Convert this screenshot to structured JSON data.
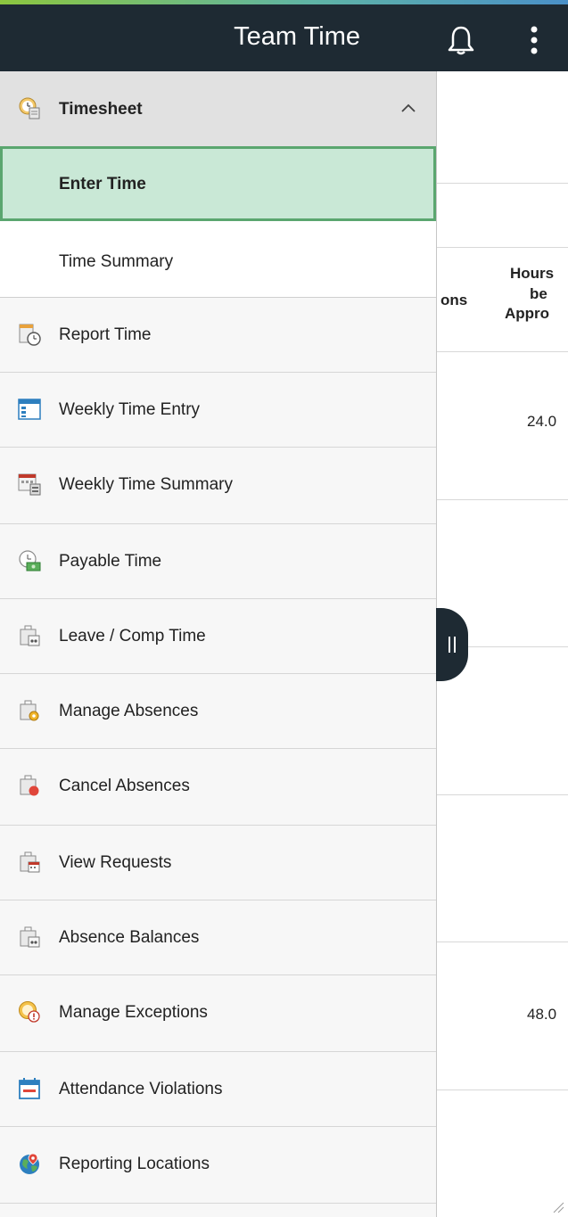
{
  "header": {
    "title": "Team Time",
    "bell_icon": "bell-icon",
    "menu_icon": "more-vertical-icon"
  },
  "background_table": {
    "col_partial_1": "ons",
    "col_hours_lines": [
      "Hours",
      "be",
      "Appro"
    ],
    "rows": [
      "24.0",
      "48.0"
    ]
  },
  "sidebar": {
    "group": {
      "label": "Timesheet",
      "icon": "timesheet-icon",
      "expanded": true
    },
    "subitems": [
      {
        "label": "Enter Time",
        "active": true
      },
      {
        "label": "Time Summary",
        "active": false
      }
    ],
    "items": [
      {
        "label": "Report Time",
        "icon": "report-time-icon"
      },
      {
        "label": "Weekly Time Entry",
        "icon": "weekly-entry-icon"
      },
      {
        "label": "Weekly Time Summary",
        "icon": "calendar-summary-icon"
      },
      {
        "label": "Payable Time",
        "icon": "payable-time-icon"
      },
      {
        "label": "Leave / Comp Time",
        "icon": "leave-icon"
      },
      {
        "label": "Manage Absences",
        "icon": "manage-absences-icon"
      },
      {
        "label": "Cancel Absences",
        "icon": "cancel-absences-icon"
      },
      {
        "label": "View Requests",
        "icon": "view-requests-icon"
      },
      {
        "label": "Absence Balances",
        "icon": "absence-balances-icon"
      },
      {
        "label": "Manage Exceptions",
        "icon": "exceptions-icon"
      },
      {
        "label": "Attendance Violations",
        "icon": "attendance-calendar-icon"
      },
      {
        "label": "Reporting Locations",
        "icon": "globe-location-icon"
      }
    ]
  },
  "colors": {
    "header_bg": "#1e2a33",
    "active_bg": "#c9e8d6",
    "active_border": "#5aa66f"
  }
}
